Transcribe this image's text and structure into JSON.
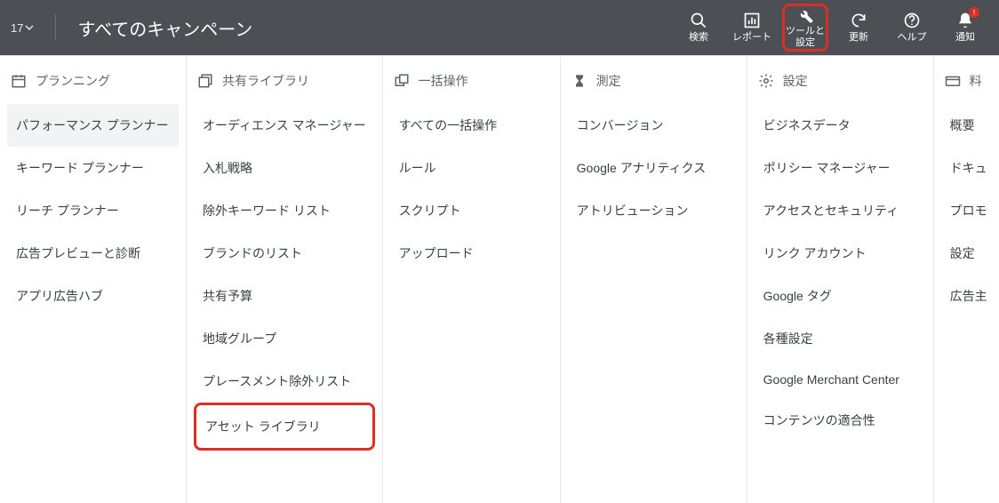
{
  "header": {
    "account_dropdown": "17",
    "title": "すべてのキャンペーン",
    "buttons": {
      "search": "検索",
      "reports": "レポート",
      "tools": "ツールと設定",
      "refresh": "更新",
      "help": "ヘルプ",
      "notifications": "通知"
    }
  },
  "menu": {
    "planning": {
      "header": "プランニング",
      "items": [
        "パフォーマンス プランナー",
        "キーワード プランナー",
        "リーチ プランナー",
        "広告プレビューと診断",
        "アプリ広告ハブ"
      ]
    },
    "shared_library": {
      "header": "共有ライブラリ",
      "items": [
        "オーディエンス マネージャー",
        "入札戦略",
        "除外キーワード リスト",
        "ブランドのリスト",
        "共有予算",
        "地域グループ",
        "プレースメント除外リスト",
        "アセット ライブラリ"
      ]
    },
    "bulk_actions": {
      "header": "一括操作",
      "items": [
        "すべての一括操作",
        "ルール",
        "スクリプト",
        "アップロード"
      ]
    },
    "measurement": {
      "header": "測定",
      "items": [
        "コンバージョン",
        "Google アナリティクス",
        "アトリビューション"
      ]
    },
    "setup": {
      "header": "設定",
      "items": [
        "ビジネスデータ",
        "ポリシー マネージャー",
        "アクセスとセキュリティ",
        "リンク アカウント",
        "Google タグ",
        "各種設定",
        "Google Merchant Center",
        "コンテンツの適合性"
      ]
    },
    "billing": {
      "header": "料",
      "items": [
        "概要",
        "ドキュ",
        "プロモ",
        "設定",
        "広告主"
      ]
    }
  }
}
